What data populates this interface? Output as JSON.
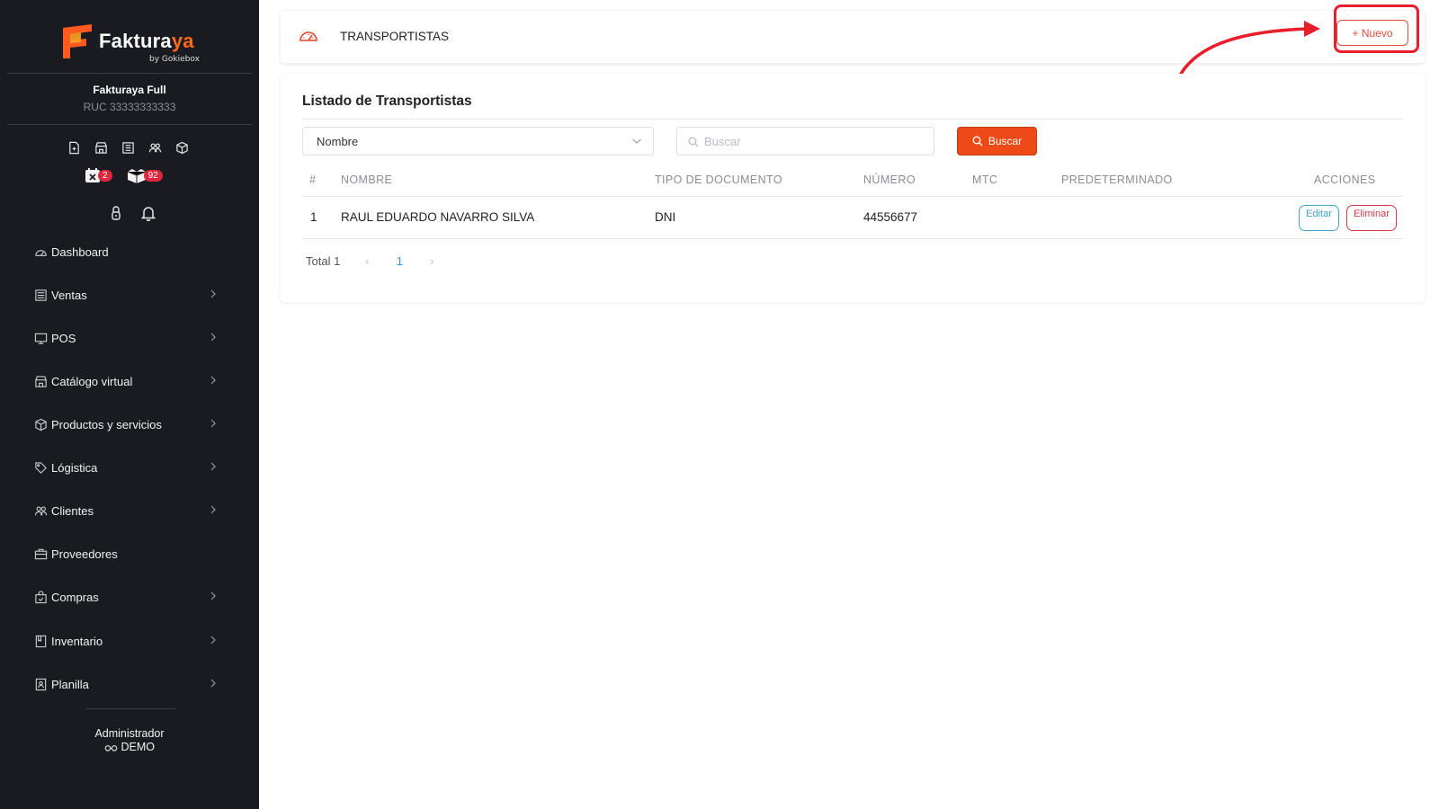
{
  "sidebar": {
    "logo": {
      "brand": "Faktura",
      "brand_accent": "ya",
      "tagline": "by Gokiebox"
    },
    "company": {
      "name": "Fakturaya Full",
      "ruc": "RUC 33333333333"
    },
    "quick_icons": [
      "document-icon",
      "store-icon",
      "receipt-icon",
      "users-icon",
      "box-icon"
    ],
    "alerts": [
      {
        "icon": "calendar-x-icon",
        "count": "2"
      },
      {
        "icon": "boxes-icon",
        "count": "92"
      }
    ],
    "tools": [
      "lock-icon",
      "bell-icon"
    ],
    "menu": [
      {
        "label": "Dashboard",
        "icon": "dashboard-icon",
        "has_children": false
      },
      {
        "label": "Ventas",
        "icon": "sales-icon",
        "has_children": true
      },
      {
        "label": "POS",
        "icon": "monitor-icon",
        "has_children": true
      },
      {
        "label": "Catálogo virtual",
        "icon": "shop-icon",
        "has_children": true
      },
      {
        "label": "Productos y servicios",
        "icon": "box-icon",
        "has_children": true
      },
      {
        "label": "Lógistica",
        "icon": "tag-icon",
        "has_children": true
      },
      {
        "label": "Clientes",
        "icon": "users-icon",
        "has_children": true
      },
      {
        "label": "Proveedores",
        "icon": "briefcase-icon",
        "has_children": false
      },
      {
        "label": "Compras",
        "icon": "shopping-bag-icon",
        "has_children": true
      },
      {
        "label": "Inventario",
        "icon": "book-icon",
        "has_children": true
      },
      {
        "label": "Planilla",
        "icon": "id-badge-icon",
        "has_children": true
      }
    ],
    "user": {
      "role": "Administrador",
      "name": "DEMO"
    }
  },
  "header": {
    "title": "TRANSPORTISTAS",
    "new_button": "+ Nuevo"
  },
  "list": {
    "title": "Listado de Transportistas",
    "filter_field": "Nombre",
    "search_placeholder": "Buscar",
    "search_button": "Buscar",
    "columns": [
      "#",
      "NOMBRE",
      "TIPO DE DOCUMENTO",
      "NÚMERO",
      "MTC",
      "PREDETERMINADO",
      "ACCIONES"
    ],
    "rows": [
      {
        "index": "1",
        "name": "RAUL EDUARDO NAVARRO SILVA",
        "doc_type": "DNI",
        "number": "44556677",
        "mtc": "",
        "default": "",
        "edit": "Editar",
        "delete": "Eliminar"
      }
    ],
    "pagination": {
      "total": "Total 1",
      "current_page": "1"
    }
  },
  "colors": {
    "sidebar_bg": "#191b20",
    "accent": "#ec4a16",
    "highlight": "#e81e2a",
    "edit": "#41a6c8",
    "delete": "#d43a4c"
  }
}
